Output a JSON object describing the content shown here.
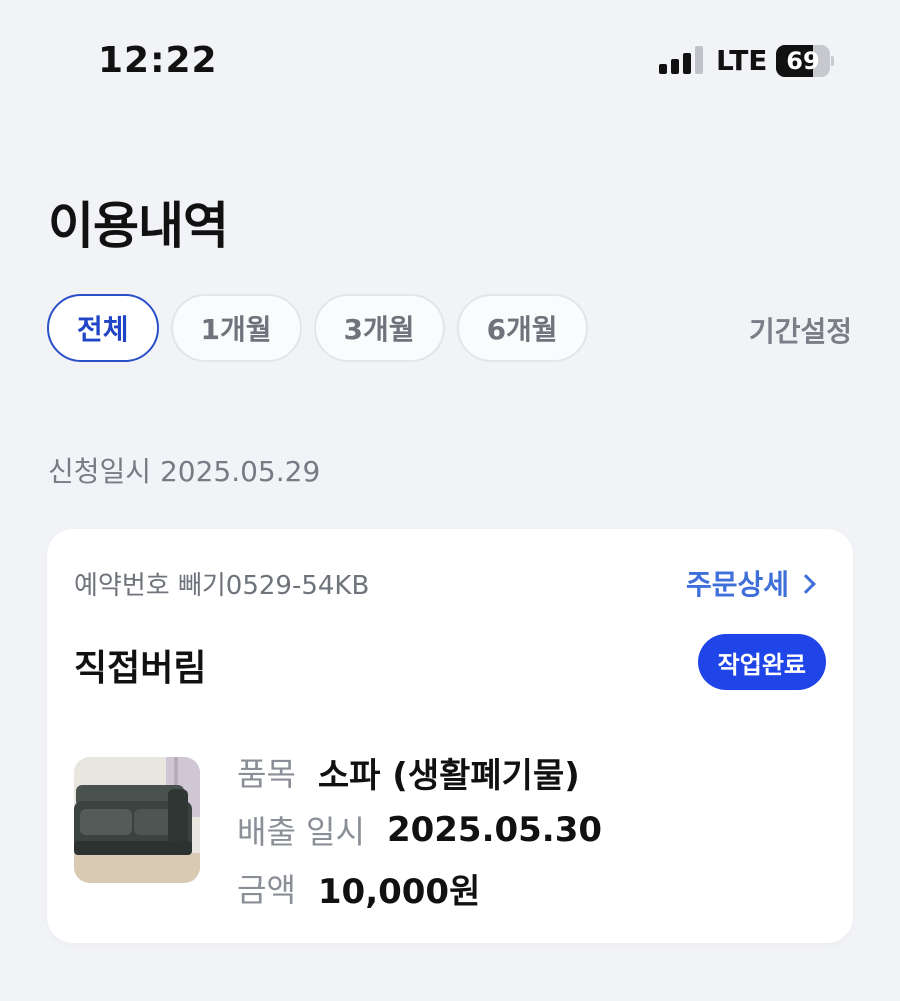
{
  "status": {
    "time": "12:22",
    "network": "LTE",
    "battery": "69",
    "battery_level": 0.69,
    "signal_bars": 3
  },
  "header": {
    "title": "이용내역"
  },
  "filters": {
    "chips": [
      "전체",
      "1개월",
      "3개월",
      "6개월"
    ],
    "active_index": 0,
    "period_setting": "기간설정"
  },
  "order": {
    "date_label": "신청일시 2025.05.29",
    "reservation": "예약번호 빼기0529-54KB",
    "detail_link": "주문상세",
    "service": "직접버림",
    "status_badge": "작업완료",
    "item_label": "품목",
    "item_value": "소파 (생활폐기물)",
    "date_out_label": "배출 일시",
    "date_out_value": "2025.05.30",
    "amount_label": "금액",
    "amount_value": "10,000원"
  },
  "colors": {
    "accent": "#1f45e8",
    "link": "#3f6fd8",
    "background": "#f2f3f7"
  }
}
